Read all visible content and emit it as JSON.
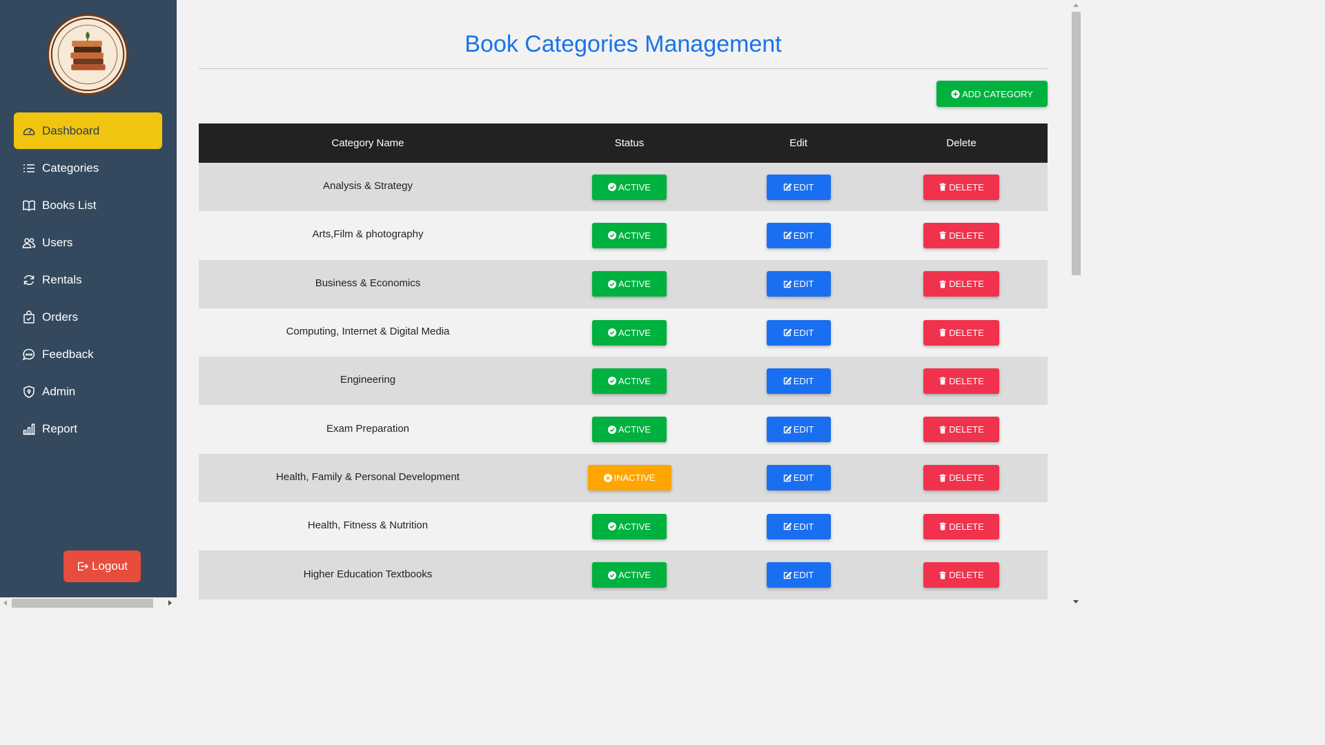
{
  "sidebar": {
    "items": [
      {
        "label": "Dashboard",
        "icon": "gauge-icon",
        "active": true
      },
      {
        "label": "Categories",
        "icon": "list-icon",
        "active": false
      },
      {
        "label": "Books List",
        "icon": "book-icon",
        "active": false
      },
      {
        "label": "Users",
        "icon": "users-icon",
        "active": false
      },
      {
        "label": "Rentals",
        "icon": "refresh-icon",
        "active": false
      },
      {
        "label": "Orders",
        "icon": "bag-icon",
        "active": false
      },
      {
        "label": "Feedback",
        "icon": "chat-icon",
        "active": false
      },
      {
        "label": "Admin",
        "icon": "shield-icon",
        "active": false
      },
      {
        "label": "Report",
        "icon": "bar-chart-icon",
        "active": false
      }
    ],
    "logout_label": "Logout"
  },
  "page": {
    "title": "Book Categories Management",
    "add_button_label": "ADD CATEGORY"
  },
  "table": {
    "headers": [
      "Category Name",
      "Status",
      "Edit",
      "Delete"
    ],
    "edit_label": "EDIT",
    "delete_label": "DELETE",
    "rows": [
      {
        "name": "Analysis & Strategy",
        "status": "ACTIVE"
      },
      {
        "name": "Arts,Film & photography",
        "status": "ACTIVE"
      },
      {
        "name": "Business & Economics",
        "status": "ACTIVE"
      },
      {
        "name": "Computing, Internet & Digital Media",
        "status": "ACTIVE"
      },
      {
        "name": "Engineering",
        "status": "ACTIVE"
      },
      {
        "name": "Exam Preparation",
        "status": "ACTIVE"
      },
      {
        "name": "Health, Family & Personal Development",
        "status": "INACTIVE"
      },
      {
        "name": "Health, Fitness & Nutrition",
        "status": "ACTIVE"
      },
      {
        "name": "Higher Education Textbooks",
        "status": "ACTIVE"
      }
    ]
  },
  "colors": {
    "sidebar_bg": "#34495e",
    "active_nav": "#f1c40f",
    "title": "#1a73e8",
    "green": "#00b140",
    "orange": "#ffa500",
    "blue": "#1a6ff0",
    "red": "#f0324d",
    "logout": "#e74c3c"
  }
}
